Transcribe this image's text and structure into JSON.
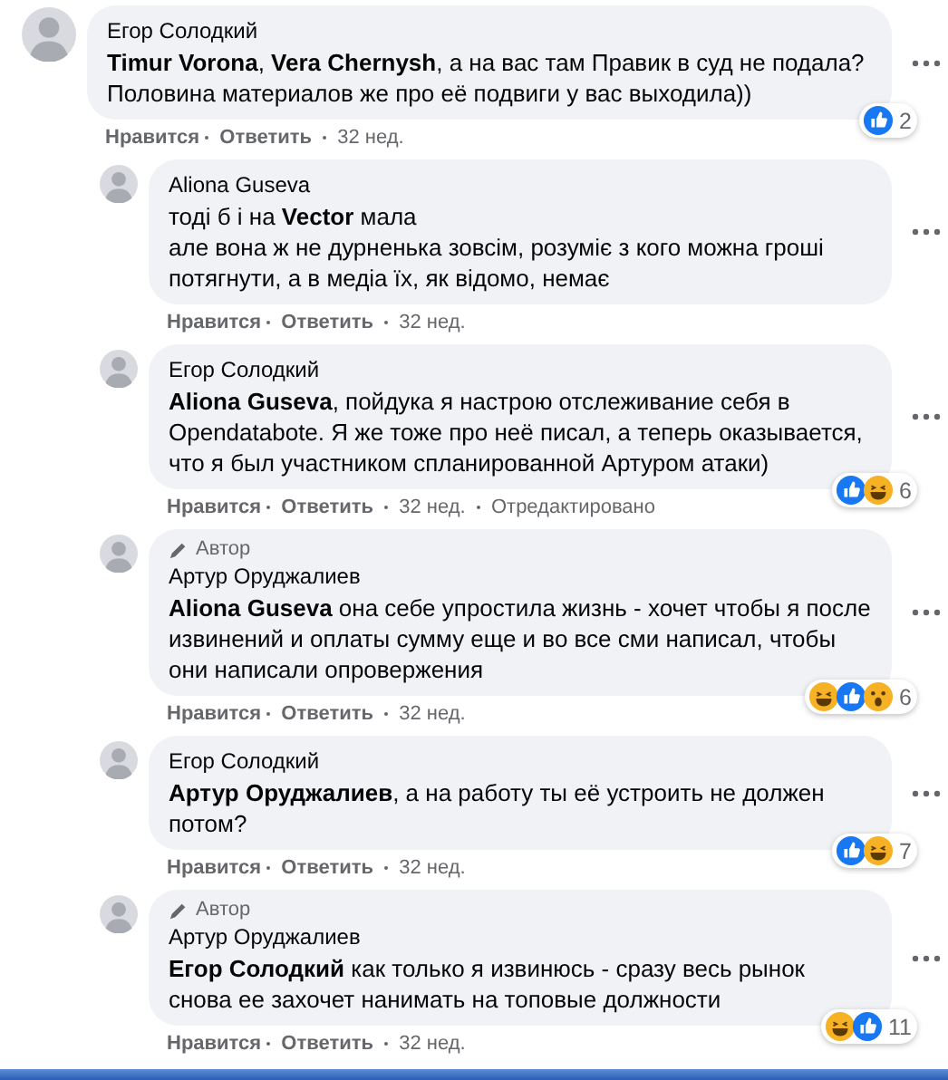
{
  "comments": [
    {
      "author": "Егор Солодкий",
      "text": "**Timur Vorona**, **Vera Chernysh**, а на вас там Правик в суд не подала? Половина материалов же про её подвиги у вас выходила))",
      "actions": [
        "Нравится",
        "Ответить"
      ],
      "time": "32 нед.",
      "reactions": {
        "icons": [
          {
            "kind": "like"
          }
        ],
        "count": "2"
      },
      "replies": [
        {
          "author": "Aliona Guseva",
          "text": "тоді б і на **Vector** мала\nале вона ж не дурненька зовсім, розуміє з кого можна гроші потягнути, а в медіа їх, як відомо, немає",
          "actions": [
            "Нравится",
            "Ответить"
          ],
          "time": "32 нед."
        },
        {
          "author": "Егор Солодкий",
          "text": "**Aliona Guseva**, пойдука я настрою отслеживание себя в Opendatabote. Я же тоже про неё писал, а теперь оказывается, что я был участником спланированной Артуром атаки)",
          "actions": [
            "Нравится",
            "Ответить"
          ],
          "time": "32 нед.",
          "edited": "Отредактировано",
          "reactions": {
            "icons": [
              {
                "kind": "like"
              },
              {
                "kind": "haha"
              }
            ],
            "count": "6"
          }
        },
        {
          "badge": "Автор",
          "author": "Артур Оруджалиев",
          "text": "**Aliona Guseva** она себе упростила жизнь - хочет чтобы я после извинений и оплаты сумму еще и во все сми написал, чтобы они написали опровержения",
          "actions": [
            "Нравится",
            "Ответить"
          ],
          "time": "32 нед.",
          "reactions": {
            "icons": [
              {
                "kind": "haha"
              },
              {
                "kind": "like"
              },
              {
                "kind": "wow"
              }
            ],
            "count": "6"
          }
        },
        {
          "author": "Егор Солодкий",
          "text": "**Артур Оруджалиев**, а на работу ты её устроить не должен потом?",
          "actions": [
            "Нравится",
            "Ответить"
          ],
          "time": "32 нед.",
          "reactions": {
            "icons": [
              {
                "kind": "like"
              },
              {
                "kind": "haha"
              }
            ],
            "count": "7"
          }
        },
        {
          "badge": "Автор",
          "author": "Артур Оруджалиев",
          "text": "**Егор Солодкий** как только я извинюсь - сразу весь рынок снова ее захочет нанимать на топовые должности",
          "actions": [
            "Нравится",
            "Ответить"
          ],
          "time": "32 нед.",
          "reactions": {
            "icons": [
              {
                "kind": "haha"
              },
              {
                "kind": "like"
              }
            ],
            "count": "11"
          }
        }
      ]
    }
  ]
}
